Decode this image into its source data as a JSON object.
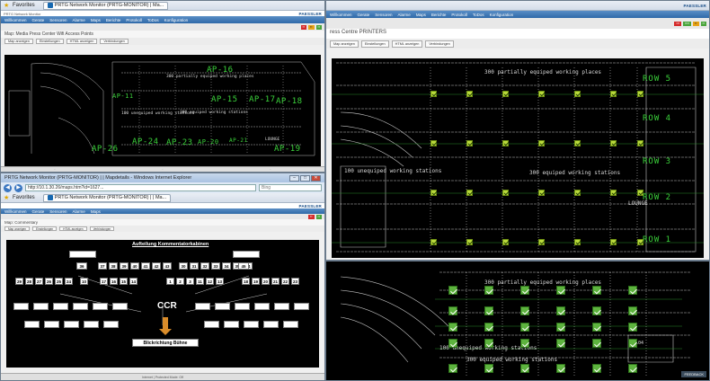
{
  "window_top_left": {
    "favorites_label": "Favorites",
    "tab_title": "PRTG Network Monitor (PRTG-MONITOR) | Ma...",
    "breadcrumb": "Map: Media Press Center Wifi Access Points",
    "header_tag": "PRTG Network Monitor",
    "brand": "PAESSLER",
    "menu": [
      "Willkommen",
      "Gerate",
      "Sensoren",
      "Alarme",
      "Maps",
      "Berichte",
      "Protokoll",
      "ToDos",
      "Konfiguration"
    ],
    "toolbar": [
      "Map anzeigen",
      "Einstellungen",
      "HTML anzeigen",
      "Verbindungen"
    ],
    "map_labels": {
      "partially": "300 partially equiped working places",
      "unequiped": "100 unequiped working stations",
      "equiped": "300 equiped working stations",
      "lounge": "LOUNGE"
    },
    "access_points": [
      "AP-16",
      "AP-11",
      "AP-15",
      "AP-17",
      "AP-18",
      "AP-26",
      "AP-24",
      "AP-23",
      "AP-20",
      "AP-21",
      "AP-19"
    ]
  },
  "window_right_top": {
    "menu": [
      "Willkommen",
      "Gerate",
      "Sensoren",
      "Alarme",
      "Maps",
      "Berichte",
      "Protokoll",
      "ToDos",
      "Konfiguration"
    ],
    "breadcrumb": "ress Centre PRINTERS",
    "toolbar": [
      "Map anzeigen",
      "Einstellungen",
      "HTML anzeigen",
      "Verbindungen"
    ],
    "brand": "PAESSLER",
    "map_labels": {
      "partially": "300 partially equiped working places",
      "unequiped": "100 unequiped working stations",
      "equiped": "300 equiped working stations",
      "lounge": "LOUNGE"
    },
    "rows": [
      "ROW 5",
      "ROW 4",
      "ROW 3",
      "ROW 2",
      "ROW 1"
    ]
  },
  "window_right_bottom": {
    "map_labels": {
      "partially": "300 partially equiped working places",
      "unequiped": "100 unequiped working stations",
      "equiped": "300 equiped working stations",
      "room": "104"
    },
    "feedback": "FEEDBACK"
  },
  "window_ie": {
    "title": "PRTG Network Monitor (PRTG-MONITOR) | | Mapdetails - Windows Internet Explorer",
    "url": "http://10.1.30.26/maps.htm?id=1627...",
    "search_placeholder": "Bing",
    "favorites_label": "Favorites",
    "tab_title": "PRTG Network Monitor (PRTG-MONITOR) | | Ma...",
    "breadcrumb": "Map: Commentary",
    "brand": "PAESSLER",
    "chart_title": "Aufteilung Kommentatorkabinen",
    "ccr": "CCR",
    "stage": "Blickrichtung Bühne",
    "status_zone": "Internet | Protected Mode: Off",
    "top_row_left": [
      "37",
      "38",
      "39",
      "40",
      "41",
      "42",
      "43"
    ],
    "top_row_right": [
      "30",
      "31",
      "32",
      "33",
      "34",
      "35",
      "44"
    ],
    "box_left_single": "36",
    "box_right_single": "45",
    "mid_left": [
      "29",
      "28",
      "27",
      "26",
      "25",
      "24"
    ],
    "mid_center_left": [
      "17",
      "16",
      "15",
      "14"
    ],
    "mid_center_right": [
      "1",
      "2",
      "3",
      "11",
      "12",
      "13"
    ],
    "mid_right": [
      "18",
      "19",
      "20",
      "21",
      "22",
      "23"
    ],
    "mid_left_extra": [
      "10"
    ]
  }
}
